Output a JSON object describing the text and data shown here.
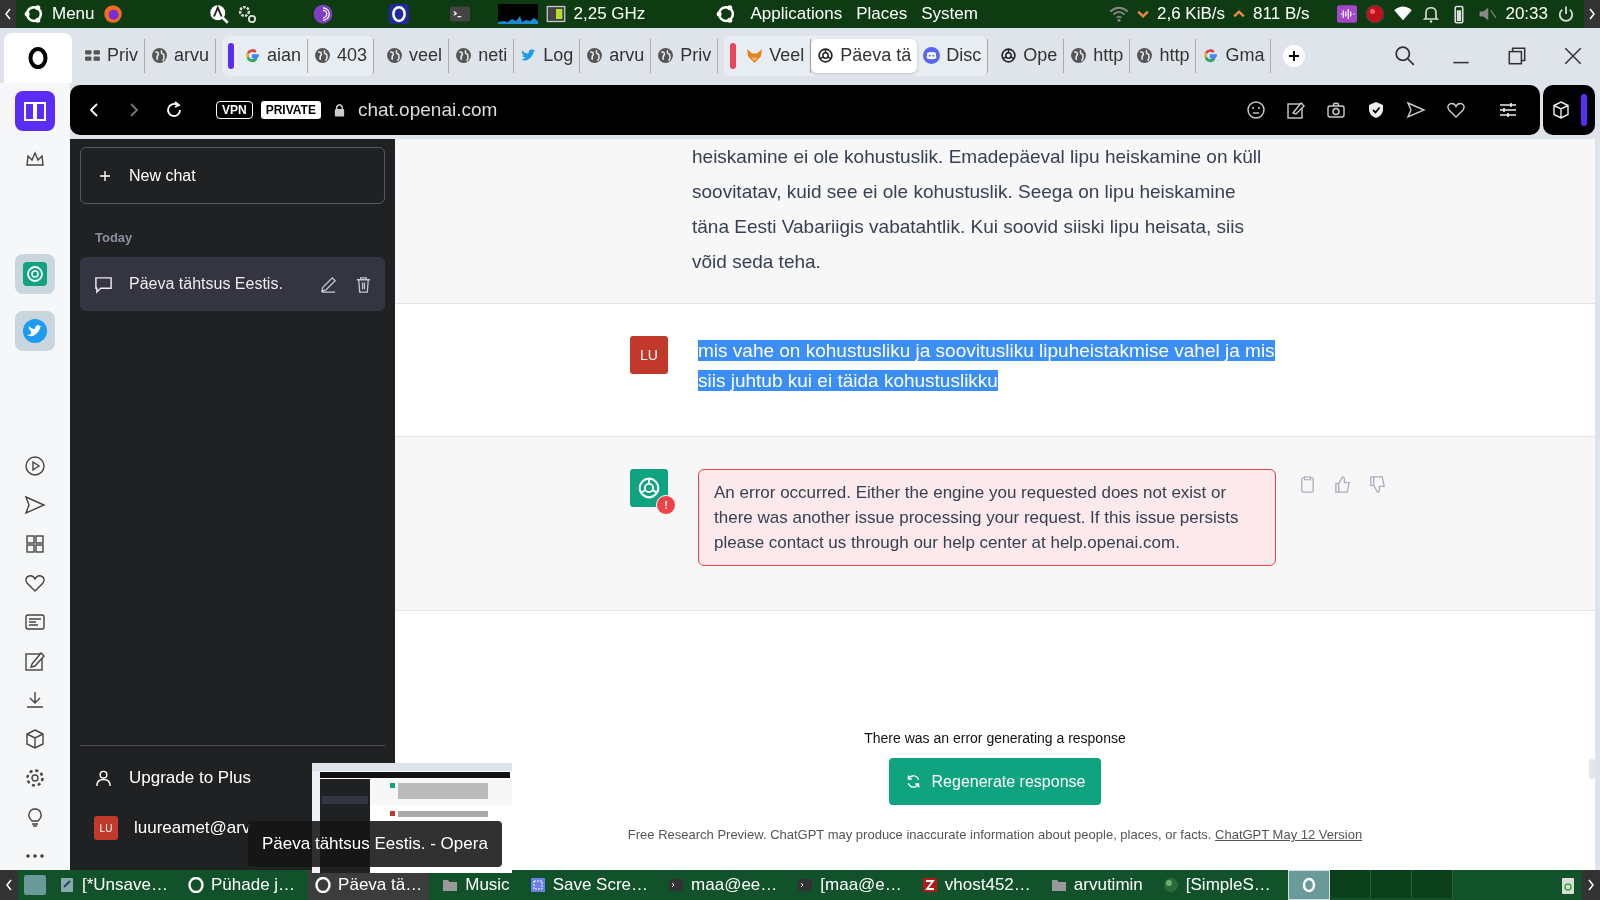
{
  "top_panel": {
    "menu": "Menu",
    "cpu": "2,25 GHz",
    "menus": [
      "Applications",
      "Places",
      "System"
    ],
    "net_down": "2,6 KiB/s",
    "net_up": "811 B/s",
    "clock": "20:33"
  },
  "tab_strip": {
    "segments": [
      {
        "tabs": [
          {
            "label": "Priv",
            "kind": "grid",
            "selected": false
          },
          {
            "label": "arvu",
            "kind": "globe",
            "selected": false
          }
        ]
      },
      {
        "color": "#5b2cf5",
        "tabs": [
          {
            "label": "aian",
            "kind": "google",
            "selected": false
          },
          {
            "label": "403",
            "kind": "globe",
            "selected": false
          }
        ]
      },
      {
        "tabs": [
          {
            "label": "veel",
            "kind": "globe",
            "selected": false
          },
          {
            "label": "neti",
            "kind": "globe",
            "selected": false
          },
          {
            "label": "Log",
            "kind": "twitter",
            "selected": false
          },
          {
            "label": "arvu",
            "kind": "globe",
            "selected": false
          },
          {
            "label": "Priv",
            "kind": "globe",
            "selected": false
          }
        ]
      },
      {
        "color": "#e5485b",
        "tabs": [
          {
            "label": "Veel",
            "kind": "fox",
            "selected": false
          },
          {
            "label": "Päeva tä",
            "kind": "gpt",
            "selected": true
          },
          {
            "label": "Disc",
            "kind": "discord",
            "selected": false
          }
        ]
      },
      {
        "tabs": [
          {
            "label": "Ope",
            "kind": "gpt",
            "selected": false
          },
          {
            "label": "http",
            "kind": "globe",
            "selected": false
          },
          {
            "label": "http",
            "kind": "globe",
            "selected": false
          },
          {
            "label": "Gma",
            "kind": "google",
            "selected": false
          }
        ]
      }
    ]
  },
  "address_bar": {
    "vpn": "VPN",
    "private": "PRIVATE",
    "url": "chat.openai.com"
  },
  "chat_sidebar": {
    "new_chat": "New chat",
    "section": "Today",
    "conversations": [
      {
        "title": "Päeva tähtsus Eestis.",
        "selected": true
      }
    ],
    "upgrade": "Upgrade to Plus",
    "user_avatar": "LU",
    "user": "luureamet@arv"
  },
  "messages": [
    {
      "kind": "assistant",
      "text": "heiskamine ei ole kohustuslik. Emadepäeval lipu heiskamine on küll soovitatav, kuid see ei ole kohustuslik. Seega on lipu heiskamine täna Eesti Vabariigis vabatahtlik. Kui soovid siiski lipu heisata, siis võid seda teha."
    },
    {
      "kind": "user",
      "avatar": "LU",
      "text": "mis vahe on kohustusliku ja soovitusliku lipuheistakmise vahel ja mis siis juhtub kui ei täida kohustuslikku",
      "text_selected": true
    },
    {
      "kind": "error",
      "badge": "!",
      "text": "An error occurred. Either the engine you requested does not exist or there was another issue processing your request. If this issue persists please contact us through our help center at help.openai.com."
    }
  ],
  "error_notice": "There was an error generating a response",
  "regenerate_button": "Regenerate response",
  "footer": {
    "text": "Free Research Preview. ChatGPT may produce inaccurate information about people, places, or facts.",
    "link": "ChatGPT May 12 Version"
  },
  "tooltip": "Päeva tähtsus Eestis. - Opera",
  "taskbar": {
    "items": [
      {
        "label": "[*Unsave…",
        "kind": "editor",
        "selected": false
      },
      {
        "label": "Pühade j…",
        "kind": "opera",
        "selected": false
      },
      {
        "label": "Päeva tä…",
        "kind": "opera",
        "selected": true
      },
      {
        "label": "Music",
        "kind": "folder",
        "selected": false
      },
      {
        "label": "Save Scre…",
        "kind": "screenshot",
        "selected": false
      },
      {
        "label": "maa@ee…",
        "kind": "terminal",
        "selected": false
      },
      {
        "label": "[maa@e…",
        "kind": "terminal",
        "selected": false
      },
      {
        "label": "vhost452…",
        "kind": "filezilla",
        "selected": false
      },
      {
        "label": "arvutimin",
        "kind": "folder",
        "selected": false
      },
      {
        "label": "[SimpleS…",
        "kind": "globe",
        "selected": false
      }
    ],
    "workspaces": [
      {
        "selected": true
      },
      {
        "selected": false
      },
      {
        "selected": false
      },
      {
        "selected": false
      }
    ]
  }
}
